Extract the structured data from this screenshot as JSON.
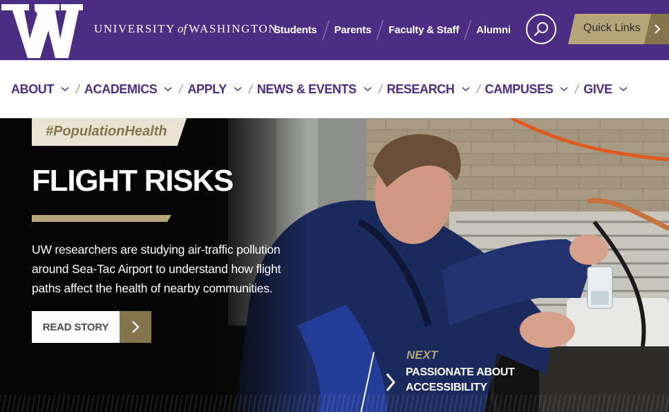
{
  "header": {
    "wordmark_left": "UNIVERSITY",
    "wordmark_of": "of",
    "wordmark_right": "WASHINGTON",
    "audience_links": [
      "Students",
      "Parents",
      "Faculty & Staff",
      "Alumni"
    ],
    "quick_links_label": "Quick Links",
    "brand_purple": "#4b2e83",
    "brand_gold": "#b7a57a",
    "brand_dark_gold": "#85754d"
  },
  "main_nav": {
    "items": [
      "ABOUT",
      "ACADEMICS",
      "APPLY",
      "NEWS & EVENTS",
      "RESEARCH",
      "CAMPUSES",
      "GIVE"
    ]
  },
  "hero": {
    "hashtag": "#PopulationHealth",
    "headline": "FLIGHT RISKS",
    "summary": "UW researchers are studying air-traffic pollution around Sea-Tac Airport to understand how flight paths affect the health of nearby communities.",
    "read_story_label": "READ STORY",
    "next_kicker": "NEXT",
    "next_title": "PASSIONATE ABOUT ACCESSIBILITY"
  }
}
